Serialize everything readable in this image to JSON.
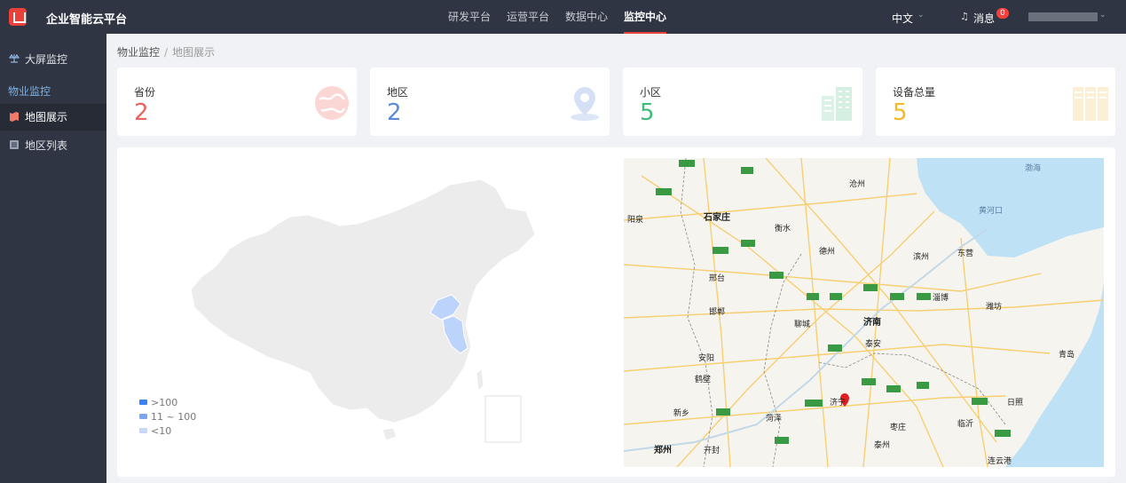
{
  "header": {
    "app_title": "企业智能云平台",
    "nav": [
      {
        "label": "研发平台",
        "active": false
      },
      {
        "label": "运营平台",
        "active": false
      },
      {
        "label": "数据中心",
        "active": false
      },
      {
        "label": "监控中心",
        "active": true
      }
    ],
    "language": "中文",
    "messages_label": "消息",
    "message_count": "0"
  },
  "sidebar": {
    "items": [
      {
        "label": "大屏监控",
        "icon": "balance-icon"
      },
      {
        "label": "地图展示",
        "icon": "map-icon",
        "active": true
      },
      {
        "label": "地区列表",
        "icon": "list-icon"
      }
    ],
    "group_label": "物业监控"
  },
  "breadcrumb": {
    "parent": "物业监控",
    "separator": "/",
    "current": "地图展示"
  },
  "stats": [
    {
      "label": "省份",
      "value": "2",
      "color": "#f0625d",
      "icon": "globe-icon"
    },
    {
      "label": "地区",
      "value": "2",
      "color": "#5b8bd6",
      "icon": "location-pin-icon"
    },
    {
      "label": "小区",
      "value": "5",
      "color": "#3dbd7d",
      "icon": "building-icon"
    },
    {
      "label": "设备总量",
      "value": "5",
      "color": "#f7b924",
      "icon": "server-rack-icon"
    }
  ],
  "china_map": {
    "legend": [
      {
        "label": ">100",
        "color": "#3b82f6"
      },
      {
        "label": "11 ~ 100",
        "color": "#7aa7ee"
      },
      {
        "label": "<10",
        "color": "#c5d9f7"
      }
    ],
    "highlight_color": "#bcd3fb",
    "base_color": "#ececec"
  },
  "detail_map": {
    "cities": [
      {
        "name": "石家庄",
        "major": true
      },
      {
        "name": "济南",
        "major": true
      },
      {
        "name": "郑州",
        "major": true
      },
      {
        "name": "黄河口",
        "sea": true
      },
      {
        "name": "渤海",
        "sea": true
      },
      {
        "name": "泰安"
      },
      {
        "name": "邢台"
      },
      {
        "name": "邯郸"
      },
      {
        "name": "聊城"
      },
      {
        "name": "德州"
      },
      {
        "name": "衡水"
      },
      {
        "name": "沧州"
      },
      {
        "name": "滨州"
      },
      {
        "name": "东营"
      },
      {
        "name": "淄博"
      },
      {
        "name": "潍坊"
      },
      {
        "name": "青岛"
      },
      {
        "name": "日照"
      },
      {
        "name": "临沂"
      },
      {
        "name": "济宁"
      },
      {
        "name": "枣庄"
      },
      {
        "name": "菏泽"
      },
      {
        "name": "新乡"
      },
      {
        "name": "安阳"
      },
      {
        "name": "鹤壁"
      },
      {
        "name": "开封"
      },
      {
        "name": "阳泉"
      },
      {
        "name": "连云港"
      },
      {
        "name": "泰州"
      }
    ],
    "marker_color": "#e02020"
  }
}
